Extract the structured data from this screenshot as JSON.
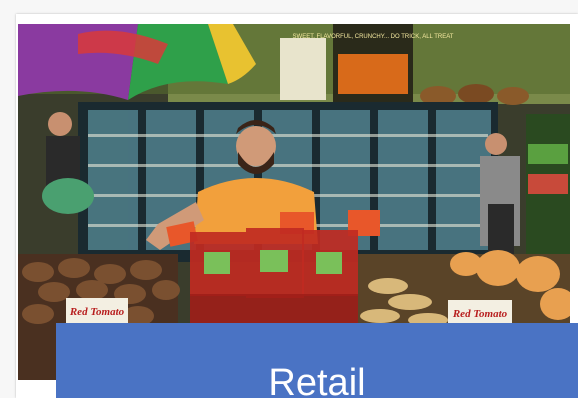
{
  "photo": {
    "sign_left": "Red Tomato",
    "sign_right": "Red Tomato",
    "poster": "SWEET, FLAVORFUL, CRUNCHY...  DO TRICK, ALL TREAT"
  },
  "banner": {
    "label": "Retail"
  },
  "colors": {
    "banner_bg": "#4a73c4",
    "shirt": "#f2a03c",
    "price_tag": "#e8572a"
  }
}
